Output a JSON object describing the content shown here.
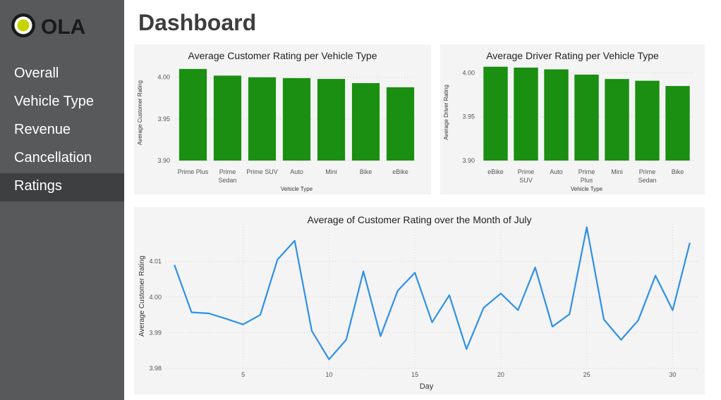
{
  "brand": {
    "name": "OLA",
    "logo_ring_color": "#1a1a1a",
    "logo_dot_color": "#c8d400"
  },
  "page": {
    "title": "Dashboard"
  },
  "sidebar": {
    "items": [
      {
        "label": "Overall",
        "active": false
      },
      {
        "label": "Vehicle Type",
        "active": false
      },
      {
        "label": "Revenue",
        "active": false
      },
      {
        "label": "Cancellation",
        "active": false
      },
      {
        "label": "Ratings",
        "active": true
      }
    ]
  },
  "colors": {
    "bar": "#1a8f12",
    "line": "#2e90e8",
    "sidebar": "#58595b",
    "sidebar_active": "#3e3f41",
    "panel": "#f4f4f4"
  },
  "chart_data": [
    {
      "type": "bar",
      "title": "Average Customer Rating per Vehicle Type",
      "xlabel": "Vehicle Type",
      "ylabel": "Average Customer Rating",
      "categories": [
        "Prime Plus",
        "Prime Sedan",
        "Prime SUV",
        "Auto",
        "Mini",
        "Bike",
        "eBike"
      ],
      "values": [
        4.01,
        4.002,
        4.0,
        3.999,
        3.998,
        3.993,
        3.988
      ],
      "ylim": [
        3.9,
        4.015
      ],
      "yticks": [
        3.9,
        3.95,
        4.0
      ],
      "ytick_labels": [
        "3.90",
        "3.95",
        "4.00"
      ],
      "grid": true
    },
    {
      "type": "bar",
      "title": "Average Driver Rating per Vehicle Type",
      "xlabel": "Vehicle Type",
      "ylabel": "Average Driver Rating",
      "categories": [
        "eBike",
        "Prime SUV",
        "Auto",
        "Prime Plus",
        "Mini",
        "Prime Sedan",
        "Bike"
      ],
      "values": [
        4.007,
        4.006,
        4.004,
        3.998,
        3.993,
        3.991,
        3.985
      ],
      "ylim": [
        3.9,
        4.01
      ],
      "yticks": [
        3.9,
        3.95,
        4.0
      ],
      "ytick_labels": [
        "3.90",
        "3.95",
        "4.00"
      ],
      "grid": true
    },
    {
      "type": "line",
      "title": "Average of Customer Rating over the Month of July",
      "xlabel": "Day",
      "ylabel": "Average Customer Rating",
      "x": [
        1,
        2,
        3,
        4,
        5,
        6,
        7,
        8,
        9,
        10,
        11,
        12,
        13,
        14,
        15,
        16,
        17,
        18,
        19,
        20,
        21,
        22,
        23,
        24,
        25,
        26,
        27,
        28,
        29,
        30,
        31
      ],
      "values": [
        4.009,
        3.9957,
        3.9954,
        3.9939,
        3.9923,
        3.995,
        4.0105,
        4.0158,
        3.9905,
        3.9825,
        3.988,
        4.0072,
        3.989,
        4.0018,
        4.0068,
        3.9929,
        4.0005,
        3.9854,
        3.997,
        4.001,
        3.9963,
        4.0083,
        3.9917,
        3.9952,
        4.0196,
        3.9937,
        3.988,
        3.9935,
        4.006,
        3.9963,
        4.0152
      ],
      "xlim": [
        0.5,
        31.5
      ],
      "xticks": [
        5,
        10,
        15,
        20,
        25,
        30
      ],
      "xtick_labels": [
        "5",
        "10",
        "15",
        "20",
        "25",
        "30"
      ],
      "ylim": [
        3.98,
        4.0205
      ],
      "yticks": [
        3.98,
        3.99,
        4.0,
        4.01
      ],
      "ytick_labels": [
        "3.98",
        "3.99",
        "4.00",
        "4.01"
      ],
      "grid": true
    }
  ]
}
